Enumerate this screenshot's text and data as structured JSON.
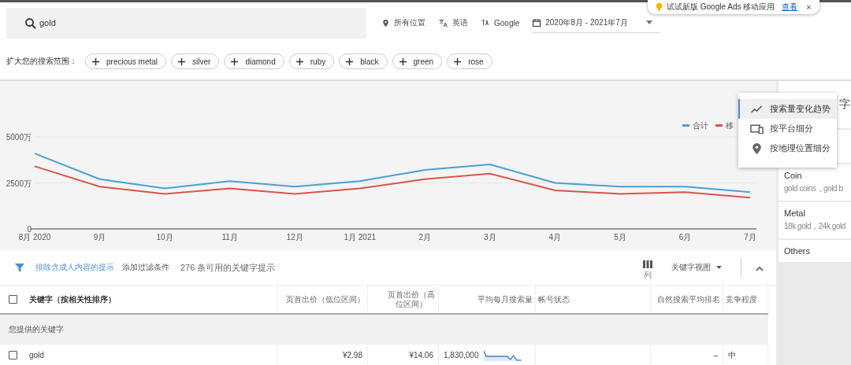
{
  "top_bar": {
    "search": {
      "value": "gold"
    },
    "location": "所有位置",
    "language": "英语",
    "network": "Google",
    "date_range": "2020年8月 - 2021年7月"
  },
  "notification": {
    "text": "试试新版 Google Ads 移动应用",
    "link": "查看",
    "close": "×"
  },
  "broaden": {
    "label": "扩大您的搜索范围：",
    "chips": [
      "precious metal",
      "silver",
      "diamond",
      "ruby",
      "black",
      "green",
      "rose"
    ]
  },
  "chart": {
    "chart_data": {
      "type": "line",
      "categories": [
        "8月 2020",
        "9月",
        "10月",
        "11月",
        "12月",
        "1月 2021",
        "2月",
        "3月",
        "4月",
        "5月",
        "6月",
        "7月"
      ],
      "legend": "top-right",
      "ylim": [
        0,
        5000
      ],
      "yticks": [
        {
          "value": 0,
          "label": "0"
        },
        {
          "value": 2500,
          "label": "2500万"
        },
        {
          "value": 5000,
          "label": "5000万"
        }
      ],
      "series": [
        {
          "name": "合计",
          "color": "#4a9fd8",
          "values": [
            4100,
            2700,
            2200,
            2600,
            2300,
            2600,
            3200,
            3500,
            2500,
            2300,
            2300,
            2000
          ]
        },
        {
          "name": "移",
          "color": "#d9554a",
          "values": [
            3400,
            2300,
            1900,
            2200,
            1900,
            2200,
            2700,
            3000,
            2100,
            1900,
            2000,
            1700
          ]
        }
      ]
    }
  },
  "view_menu": {
    "items": [
      {
        "label": "搜索量变化趋势",
        "selected": true
      },
      {
        "label": "按平台细分",
        "selected": false
      },
      {
        "label": "按地理位置细分",
        "selected": false
      }
    ]
  },
  "filter_bar": {
    "filter": "排除含成人内容的提示",
    "add_filter": "添加过滤条件",
    "count": "276 条可用的关键字提示",
    "columns_label": "列",
    "view": "关键字视图"
  },
  "table": {
    "header_checked": false,
    "columns": [
      "关键字（按相关性排序）",
      "页首出价（低位区间）",
      "页首出价（高位区间）",
      "平均每月搜索量",
      "帐号状态",
      "自然搜索平均排名",
      "竞争程度"
    ],
    "group": "您提供的关键字",
    "rows": [
      {
        "checked": false,
        "keyword": "gold",
        "bid_low": "¥2.98",
        "bid_high": "¥14.06",
        "searches": "1,830,000",
        "rank": "–",
        "competition": "中"
      }
    ]
  },
  "sidebar": {
    "heading": "字",
    "cards": [
      {
        "title": "Coin",
        "subtitle": "gold coins，gold b"
      },
      {
        "title": "Metal",
        "subtitle": "18k gold，24k gold"
      },
      {
        "title": "Others"
      }
    ]
  }
}
